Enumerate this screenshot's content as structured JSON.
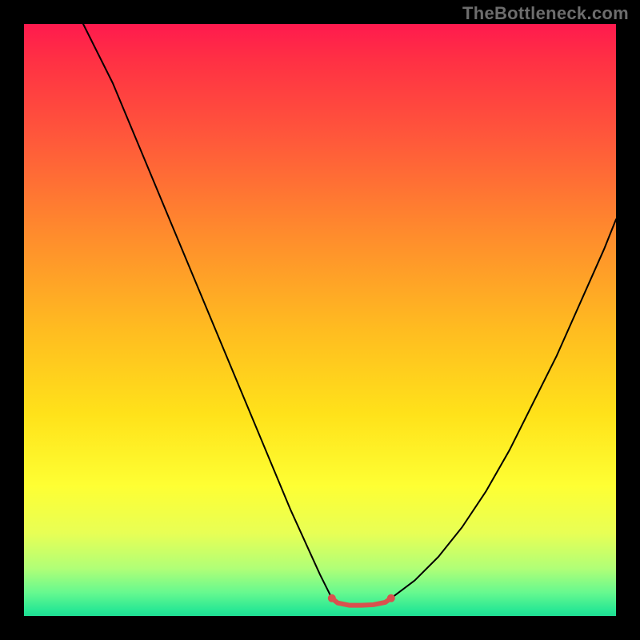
{
  "watermark": {
    "text": "TheBottleneck.com"
  },
  "chart_data": {
    "type": "line",
    "title": "",
    "xlabel": "",
    "ylabel": "",
    "xlim": [
      0,
      100
    ],
    "ylim": [
      0,
      100
    ],
    "grid": false,
    "legend": false,
    "annotations": [],
    "series": [
      {
        "name": "left-curve",
        "color": "#000000",
        "stroke_width": 2,
        "x": [
          10,
          15,
          20,
          25,
          30,
          35,
          40,
          45,
          50,
          52
        ],
        "y": [
          100,
          90,
          78,
          66,
          54,
          42,
          30,
          18,
          7,
          3
        ]
      },
      {
        "name": "right-curve",
        "color": "#000000",
        "stroke_width": 2,
        "x": [
          62,
          66,
          70,
          74,
          78,
          82,
          86,
          90,
          94,
          98,
          100
        ],
        "y": [
          3,
          6,
          10,
          15,
          21,
          28,
          36,
          44,
          53,
          62,
          67
        ]
      },
      {
        "name": "valley-marker",
        "color": "#d9514e",
        "stroke_width": 6,
        "endcap_radius": 5,
        "x": [
          52,
          53,
          55,
          57,
          59,
          61,
          62
        ],
        "y": [
          3,
          2.2,
          1.8,
          1.8,
          1.9,
          2.3,
          3
        ]
      }
    ],
    "gradient_stops": [
      {
        "pos": 0.0,
        "color": "#ff1a4e"
      },
      {
        "pos": 0.06,
        "color": "#ff3044"
      },
      {
        "pos": 0.2,
        "color": "#ff5a3a"
      },
      {
        "pos": 0.35,
        "color": "#ff8a2d"
      },
      {
        "pos": 0.52,
        "color": "#ffbd20"
      },
      {
        "pos": 0.66,
        "color": "#ffe21a"
      },
      {
        "pos": 0.78,
        "color": "#feff33"
      },
      {
        "pos": 0.86,
        "color": "#e8ff55"
      },
      {
        "pos": 0.92,
        "color": "#b0ff77"
      },
      {
        "pos": 0.96,
        "color": "#67f98f"
      },
      {
        "pos": 0.99,
        "color": "#29e894"
      },
      {
        "pos": 1.0,
        "color": "#1fdc93"
      }
    ]
  }
}
